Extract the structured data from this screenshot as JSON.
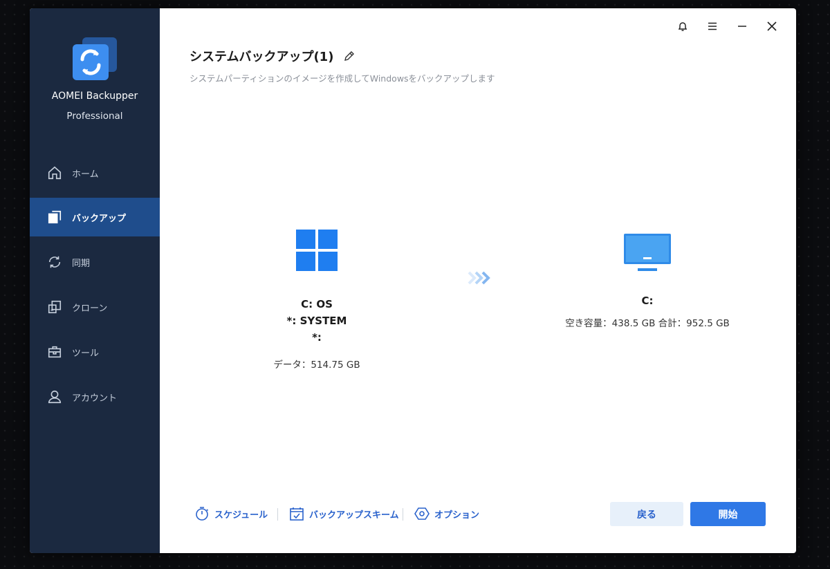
{
  "app": {
    "name": "AOMEI Backupper",
    "edition": "Professional"
  },
  "sidebar": {
    "items": [
      {
        "label": "ホーム",
        "icon": "home-icon"
      },
      {
        "label": "バックアップ",
        "icon": "backup-icon",
        "active": true
      },
      {
        "label": "同期",
        "icon": "sync-icon"
      },
      {
        "label": "クローン",
        "icon": "clone-icon"
      },
      {
        "label": "ツール",
        "icon": "toolbox-icon"
      },
      {
        "label": "アカウント",
        "icon": "user-icon"
      }
    ]
  },
  "header": {
    "title": "システムバックアップ(1)",
    "subtitle": "システムパーティションのイメージを作成してWindowsをバックアップします"
  },
  "window_controls": [
    "bell-icon",
    "menu-icon",
    "minimize-icon",
    "close-icon"
  ],
  "source": {
    "line1": "C: OS",
    "line2": "*: SYSTEM",
    "line3": "*:",
    "data": "データ：514.75 GB"
  },
  "destination": {
    "drive": "C:",
    "info": "空き容量：438.5 GB 合計：952.5 GB"
  },
  "footer": {
    "schedule": "スケジュール",
    "scheme": "バックアップスキーム",
    "options": "オプション",
    "back": "戻る",
    "start": "開始"
  },
  "colors": {
    "sidebar": "#1b2940",
    "active": "#1f4d8c",
    "accent": "#2f78e6",
    "link": "#2a62cc"
  }
}
